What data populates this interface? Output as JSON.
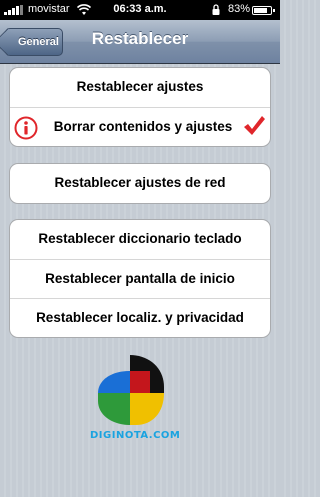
{
  "status_bar": {
    "carrier": "movistar",
    "time": "06:33 a.m.",
    "battery_percent": "83%",
    "battery_level": 0.83,
    "icons": [
      "signal-icon",
      "wifi-icon",
      "lock-icon",
      "battery-icon"
    ]
  },
  "nav": {
    "back_label": "General",
    "title": "Restablecer"
  },
  "groups": {
    "reset": {
      "items": [
        {
          "label": "Restablecer ajustes"
        },
        {
          "label": "Borrar contenidos y ajustes",
          "icon": "info-icon",
          "accessory": "checkmark-icon"
        }
      ]
    },
    "network": {
      "items": [
        {
          "label": "Restablecer ajustes de red"
        }
      ]
    },
    "other": {
      "items": [
        {
          "label": "Restablecer diccionario teclado"
        },
        {
          "label": "Restablecer pantalla de inicio"
        },
        {
          "label": "Restablecer localiz. y privacidad"
        }
      ]
    }
  },
  "watermark": {
    "text": "DIGINOTA.COM"
  },
  "colors": {
    "navbar": "#7f91aa",
    "background": "#c5ccd4",
    "warning_red": "#e0262b",
    "watermark_blue": "#1aa3e0"
  }
}
